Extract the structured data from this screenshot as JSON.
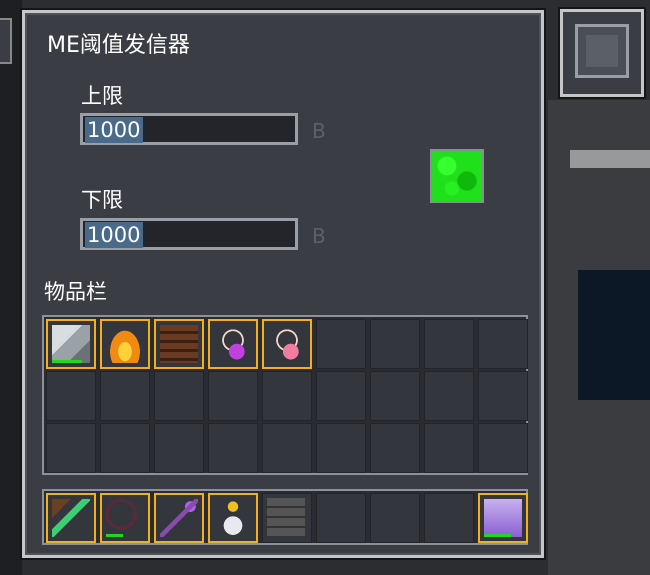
{
  "window": {
    "title": "ME阈值发信器"
  },
  "upper": {
    "label": "上限",
    "value": "1000",
    "unit": "B"
  },
  "lower": {
    "label": "下限",
    "value": "1000",
    "unit": "B"
  },
  "signal_color": "#1fe01a",
  "inventory": {
    "label": "物品栏",
    "slots": [
      {
        "icon": "ore-block-icon",
        "filled": true,
        "dur": 0.8
      },
      {
        "icon": "fire-icon",
        "filled": true
      },
      {
        "icon": "bookshelf-icon",
        "filled": true
      },
      {
        "icon": "amulet-purple-icon",
        "filled": true
      },
      {
        "icon": "amulet-pink-icon",
        "filled": true
      }
    ],
    "hotbar": [
      {
        "icon": "green-sword-icon",
        "filled": true
      },
      {
        "icon": "dark-bow-icon",
        "filled": true,
        "dur": 0.45
      },
      {
        "icon": "purple-staff-icon",
        "filled": true
      },
      {
        "icon": "potion-bottle-icon",
        "filled": true
      },
      {
        "icon": "stone-block-icon",
        "filled": false
      },
      {
        "icon": "scroll-icon",
        "filled": true,
        "slot": 8,
        "dur": 0.7
      }
    ]
  }
}
